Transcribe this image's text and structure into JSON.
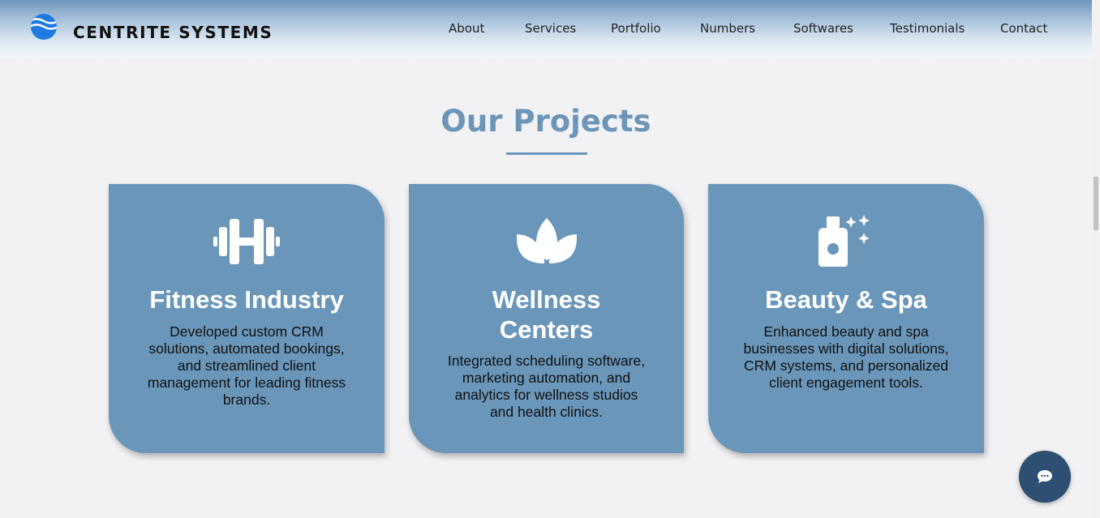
{
  "header": {
    "brand": "CENTRITE SYSTEMS",
    "logo_icon": "wave-globe-icon",
    "nav": [
      "About",
      "Services",
      "Portfolio",
      "Numbers",
      "Softwares",
      "Testimonials",
      "Contact"
    ]
  },
  "section": {
    "title": "Our Projects"
  },
  "cards": [
    {
      "icon": "dumbbell-icon",
      "title": "Fitness Industry",
      "description": "Developed custom CRM solutions, automated bookings, and streamlined client management for leading fitness brands."
    },
    {
      "icon": "lotus-icon",
      "title_line1": "Wellness",
      "title_line2": "Centers",
      "description": "Integrated scheduling software, marketing automation, and analytics for wellness studios and health clinics."
    },
    {
      "icon": "sparkling-bottle-icon",
      "title": "Beauty & Spa",
      "description": "Enhanced beauty and spa businesses with digital solutions, CRM systems, and personalized client engagement tools."
    }
  ],
  "chat": {
    "icon": "chat-bubble-icon"
  },
  "colors": {
    "accent": "#6b95b9",
    "card": "#6a96b9",
    "chat": "#2e4f71",
    "background": "#f2f1f4"
  }
}
